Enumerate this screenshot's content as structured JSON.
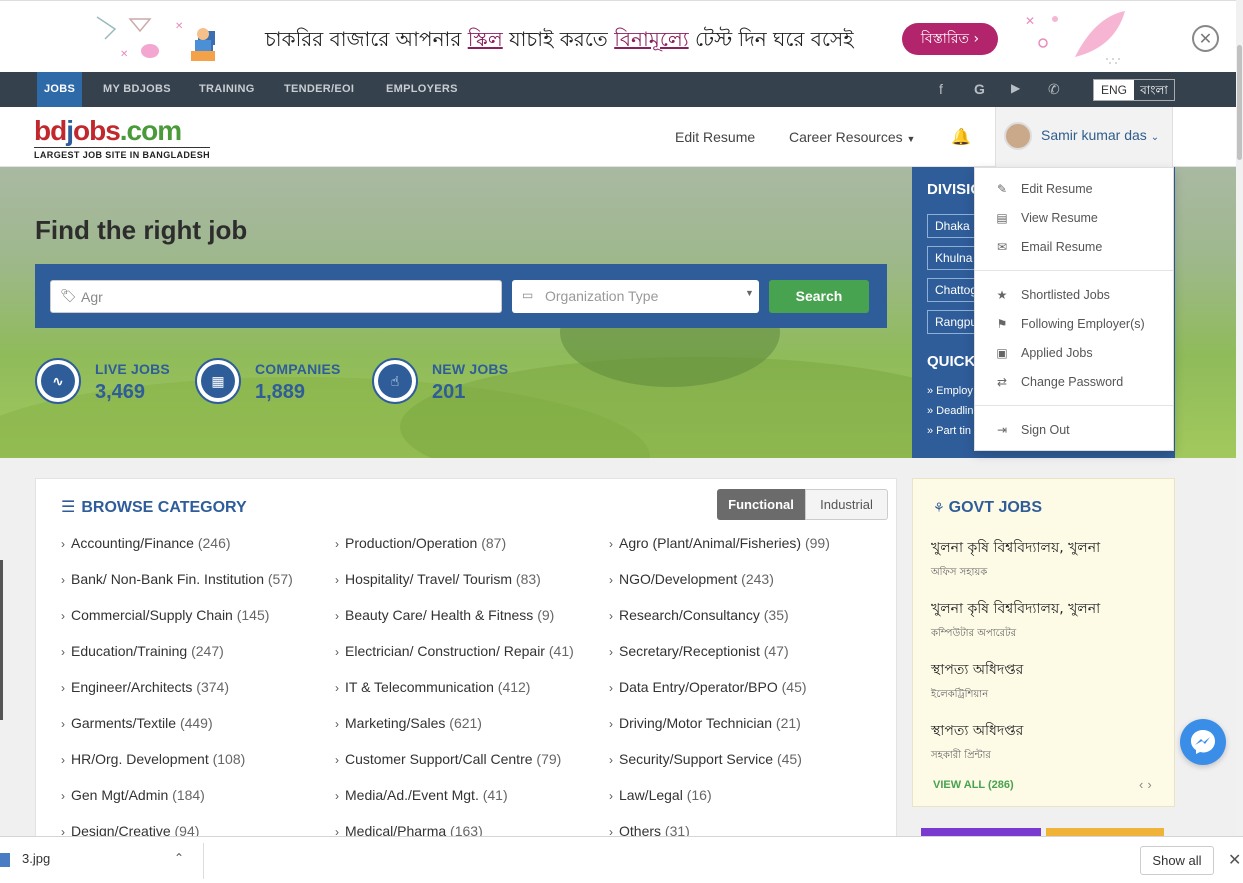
{
  "banner": {
    "text_pre": "চাকরির বাজারে আপনার ",
    "text_hl1": "স্কিল",
    "text_mid": " যাচাই করতে ",
    "text_hl2": "বিনামূল্যে",
    "text_post": " টেস্ট দিন ঘরে বসেই",
    "button_label": "বিস্তারিত ›",
    "close_icon": "close-circle-icon"
  },
  "topnav": {
    "items": [
      "JOBS",
      "MY BDJOBS",
      "TRAINING",
      "TENDER/EOI",
      "EMPLOYERS"
    ],
    "lang_en": "ENG",
    "lang_bn": "বাংলা"
  },
  "header": {
    "logo_sub": "LARGEST JOB SITE IN BANGLADESH",
    "edit_resume": "Edit Resume",
    "career_resources": "Career Resources",
    "user_name": "Samir kumar das"
  },
  "hero": {
    "title": "Find the right job",
    "keyword_value": "Agr",
    "org_type_placeholder": "Organization Type",
    "search_label": "Search",
    "stats": [
      {
        "label": "LIVE JOBS",
        "value": "3,469",
        "icon": "pulse-icon"
      },
      {
        "label": "COMPANIES",
        "value": "1,889",
        "icon": "building-icon"
      },
      {
        "label": "NEW JOBS",
        "value": "201",
        "icon": "pointer-icon"
      }
    ]
  },
  "division": {
    "title": "DIVISIO",
    "items": [
      "Dhaka",
      "Khulna",
      "Chattog",
      "Rangpu"
    ],
    "quick_title": "QUICK",
    "quick_links": [
      "» Employ",
      "» Deadlin",
      "» Part tin"
    ]
  },
  "user_menu": {
    "items": [
      {
        "label": "Edit Resume",
        "icon": "edit-icon"
      },
      {
        "label": "View Resume",
        "icon": "view-resume-icon"
      },
      {
        "label": "Email Resume",
        "icon": "email-icon"
      },
      {
        "label": "Shortlisted Jobs",
        "icon": "star-icon"
      },
      {
        "label": "Following Employer(s)",
        "icon": "following-icon"
      },
      {
        "label": "Applied Jobs",
        "icon": "applied-icon"
      },
      {
        "label": "Change Password",
        "icon": "password-icon"
      },
      {
        "label": "Sign Out",
        "icon": "sign-out-icon"
      }
    ]
  },
  "categories": {
    "title": "BROWSE CATEGORY",
    "tab_functional": "Functional",
    "tab_industrial": "Industrial",
    "col1": [
      {
        "name": "Accounting/Finance",
        "count": "(246)"
      },
      {
        "name": "Bank/ Non-Bank Fin. Institution",
        "count": "(57)"
      },
      {
        "name": "Commercial/Supply Chain",
        "count": "(145)"
      },
      {
        "name": "Education/Training",
        "count": "(247)"
      },
      {
        "name": "Engineer/Architects",
        "count": "(374)"
      },
      {
        "name": "Garments/Textile",
        "count": "(449)"
      },
      {
        "name": "HR/Org. Development",
        "count": "(108)"
      },
      {
        "name": "Gen Mgt/Admin",
        "count": "(184)"
      },
      {
        "name": "Design/Creative",
        "count": "(94)"
      }
    ],
    "col2": [
      {
        "name": "Production/Operation",
        "count": "(87)"
      },
      {
        "name": "Hospitality/ Travel/ Tourism",
        "count": "(83)"
      },
      {
        "name": "Beauty Care/ Health & Fitness",
        "count": "(9)"
      },
      {
        "name": "Electrician/ Construction/ Repair",
        "count": "(41)"
      },
      {
        "name": "IT & Telecommunication",
        "count": "(412)"
      },
      {
        "name": "Marketing/Sales",
        "count": "(621)"
      },
      {
        "name": "Customer Support/Call Centre",
        "count": "(79)"
      },
      {
        "name": "Media/Ad./Event Mgt.",
        "count": "(41)"
      },
      {
        "name": "Medical/Pharma",
        "count": "(163)"
      }
    ],
    "col3": [
      {
        "name": "Agro (Plant/Animal/Fisheries)",
        "count": "(99)"
      },
      {
        "name": "NGO/Development",
        "count": "(243)"
      },
      {
        "name": "Research/Consultancy",
        "count": "(35)"
      },
      {
        "name": "Secretary/Receptionist",
        "count": "(47)"
      },
      {
        "name": "Data Entry/Operator/BPO",
        "count": "(45)"
      },
      {
        "name": "Driving/Motor Technician",
        "count": "(21)"
      },
      {
        "name": "Security/Support Service",
        "count": "(45)"
      },
      {
        "name": "Law/Legal",
        "count": "(16)"
      },
      {
        "name": "Others",
        "count": "(31)"
      }
    ]
  },
  "govt": {
    "title": "GOVT JOBS",
    "jobs": [
      {
        "org": "খুলনা কৃষি বিশ্ববিদ্যালয়, খুলনা",
        "position": "অফিস সহায়ক"
      },
      {
        "org": "খুলনা কৃষি বিশ্ববিদ্যালয়, খুলনা",
        "position": "কম্পিউটার অপারেটর"
      },
      {
        "org": "স্থাপত্য অধিদপ্তর",
        "position": "ইলেকট্রিশিয়ান"
      },
      {
        "org": "স্থাপত্য অধিদপ্তর",
        "position": "সহকারী প্রিন্টার"
      }
    ],
    "view_all": "VIEW ALL (286)"
  },
  "download_bar": {
    "file_name": "3.jpg",
    "show_all": "Show all"
  },
  "colors": {
    "brand_blue": "#2f5d9a",
    "nav_dark": "#35414d",
    "search_green": "#47a34f",
    "banner_magenta": "#b2246c"
  }
}
